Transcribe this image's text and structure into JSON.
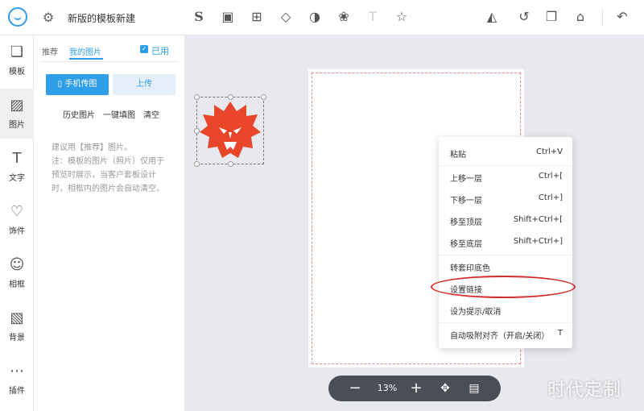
{
  "header": {
    "title": "新版的模板新建",
    "tool_icons": [
      "text-style-icon",
      "layer-icon",
      "grid-icon",
      "fill-icon",
      "contrast-icon",
      "group-icon",
      "text-icon",
      "star-icon"
    ],
    "right_icons": [
      "flip-icon",
      "rotate-icon",
      "copy-icon",
      "lock-icon",
      "undo-icon"
    ]
  },
  "rail": {
    "items": [
      {
        "label": "模板",
        "icon": "template-icon"
      },
      {
        "label": "图片",
        "icon": "image-icon"
      },
      {
        "label": "文字",
        "icon": "text-icon"
      },
      {
        "label": "饰件",
        "icon": "decoration-icon"
      },
      {
        "label": "相框",
        "icon": "frame-icon"
      },
      {
        "label": "背景",
        "icon": "background-icon"
      },
      {
        "label": "插件",
        "icon": "plugin-icon"
      }
    ]
  },
  "panel": {
    "tabs": [
      "推荐",
      "我的图片"
    ],
    "used_label": "已用",
    "phone_upload_label": "手机传图",
    "upload_label": "上传",
    "links": [
      "历史图片",
      "一键填图",
      "清空"
    ],
    "tip_lines": [
      "建议用【推荐】图片。",
      "注：模板的图片（照片）仅用于",
      "预览时展示，当客户套板设计",
      "时，相框内的图片会自动清空。"
    ]
  },
  "context_menu": {
    "items": [
      {
        "label": "粘贴",
        "shortcut": "Ctrl+V"
      },
      {
        "label": "上移一层",
        "shortcut": "Ctrl+["
      },
      {
        "label": "下移一层",
        "shortcut": "Ctrl+]"
      },
      {
        "label": "移至顶层",
        "shortcut": "Shift+Ctrl+["
      },
      {
        "label": "移至底层",
        "shortcut": "Shift+Ctrl+]"
      },
      {
        "label": "转套印底色",
        "shortcut": ""
      },
      {
        "label": "设置链接",
        "shortcut": ""
      },
      {
        "label": "设为提示/取消",
        "shortcut": ""
      },
      {
        "label": "自动吸附对齐（开启/关闭）",
        "shortcut": "T"
      }
    ],
    "highlighted": "设置链接",
    "highlight_color": "#d42c2c"
  },
  "zoom": {
    "minus": "−",
    "level": "13%",
    "plus": "+"
  },
  "watermark": "时代定制",
  "colors": {
    "accent": "#2f9ee8",
    "logo_red": "#e8452a"
  }
}
